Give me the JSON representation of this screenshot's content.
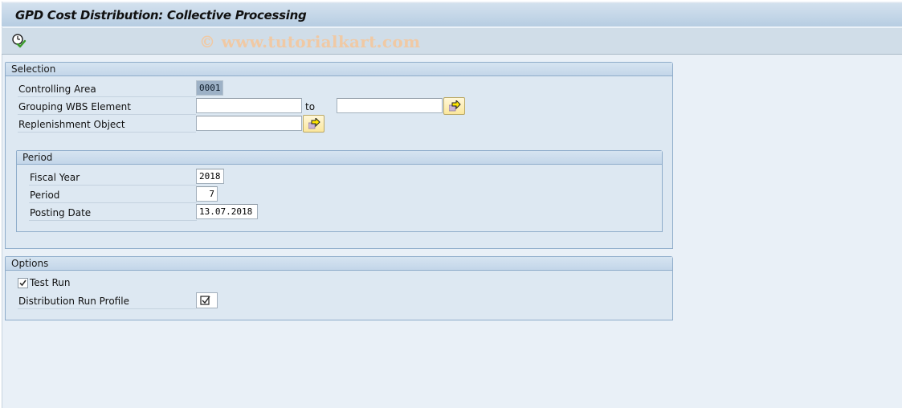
{
  "window": {
    "title": "GPD Cost Distribution: Collective Processing"
  },
  "toolbar": {
    "execute_icon": "execute-clock-check-icon",
    "watermark": "© www.tutorialkart.com"
  },
  "selection": {
    "header": "Selection",
    "controlling_area": {
      "label": "Controlling Area",
      "value": "0001"
    },
    "grouping_wbs": {
      "label": "Grouping WBS Element",
      "from_value": "",
      "to_label": "to",
      "to_value": "",
      "multi_icon": "multiple-selection-arrow-icon"
    },
    "replenishment": {
      "label": "Replenishment Object",
      "value": "",
      "multi_icon": "multiple-selection-arrow-icon"
    },
    "period_group": {
      "header": "Period",
      "fiscal_year": {
        "label": "Fiscal Year",
        "value": "2018"
      },
      "period": {
        "label": "Period",
        "value": "7"
      },
      "posting_date": {
        "label": "Posting Date",
        "value": "13.07.2018"
      }
    }
  },
  "options": {
    "header": "Options",
    "test_run": {
      "label": "Test Run",
      "checked": true
    },
    "distribution_run_profile": {
      "label": "Distribution Run Profile",
      "icon": "checkbox-value-icon"
    }
  },
  "colors": {
    "background": "#e9f0f7",
    "group_fill": "#dde8f2",
    "group_border": "#8eacca",
    "watermark": "#f0c9a4",
    "highlight_field": "#9db1c6"
  }
}
